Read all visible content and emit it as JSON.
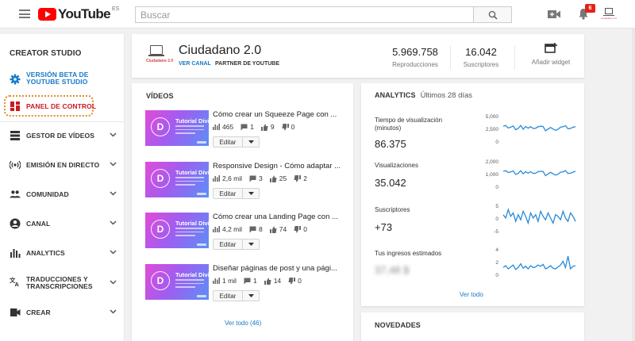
{
  "topbar": {
    "logo_text": "YouTube",
    "logo_region": "ES",
    "search_placeholder": "Buscar",
    "notification_count": "6",
    "avatar_text": "Ciudadano 2.0"
  },
  "sidebar": {
    "heading": "CREATOR STUDIO",
    "items": [
      {
        "label": "VERSIÓN BETA DE\nYOUTUBE STUDIO",
        "icon": "gear-icon"
      },
      {
        "label": "PANEL DE CONTROL",
        "icon": "dashboard-icon"
      },
      {
        "label": "GESTOR DE VÍDEOS",
        "icon": "video-manager-icon"
      },
      {
        "label": "EMISIÓN EN DIRECTO",
        "icon": "live-icon"
      },
      {
        "label": "COMUNIDAD",
        "icon": "community-icon"
      },
      {
        "label": "CANAL",
        "icon": "channel-icon"
      },
      {
        "label": "ANALYTICS",
        "icon": "analytics-icon"
      },
      {
        "label": "TRADUCCIONES Y\nTRANSCRIPCIONES",
        "icon": "translate-icon"
      },
      {
        "label": "CREAR",
        "icon": "create-icon"
      }
    ]
  },
  "channel": {
    "name": "Ciudadano 2.0",
    "avatar_text": "Ciudadano 2.0",
    "view_channel": "VER CANAL",
    "partner": "PARTNER DE YOUTUBE",
    "stats": [
      {
        "value": "5.969.758",
        "label": "Reproducciones"
      },
      {
        "value": "16.042",
        "label": "Suscriptores"
      }
    ],
    "add_widget": "Añadir widget"
  },
  "videos": {
    "title": "VÍDEOS",
    "edit_label": "Editar",
    "see_all": "Ver todo (46)",
    "items": [
      {
        "title": "Cómo crear un Squeeze Page con ...",
        "thumb_title": "Tutorial Divi",
        "views": "465",
        "comments": "1",
        "likes": "9",
        "dislikes": "0"
      },
      {
        "title": "Responsive Design - Cómo adaptar ...",
        "thumb_title": "Tutorial Divi",
        "views": "2,6 mil",
        "comments": "3",
        "likes": "25",
        "dislikes": "2"
      },
      {
        "title": "Cómo crear una Landing Page con ...",
        "thumb_title": "Tutorial Divi",
        "views": "4,2 mil",
        "comments": "8",
        "likes": "74",
        "dislikes": "0"
      },
      {
        "title": "Diseñar páginas de post y una pági...",
        "thumb_title": "Tutorial Divi",
        "views": "1 mil",
        "comments": "1",
        "likes": "14",
        "dislikes": "0"
      }
    ]
  },
  "analytics": {
    "title": "ANALYTICS",
    "period": "Últimos 28 días",
    "see_all": "Ver todo",
    "metrics": [
      {
        "label": "Tiempo de visualización (minutos)",
        "value": "86.375",
        "ticks": [
          "5,000",
          "2,500",
          "0"
        ],
        "points": [
          3100,
          3250,
          2750,
          2900,
          3150,
          2400,
          2650,
          3250,
          2500,
          3050,
          2700,
          3000,
          2650,
          2700,
          3000,
          3100,
          3050,
          2200,
          2550,
          2850,
          2550,
          2300,
          2500,
          2900,
          3000,
          3200,
          2600,
          2650,
          2900,
          3000
        ],
        "ymax": 5000,
        "ymin": 0
      },
      {
        "label": "Visualizaciones",
        "value": "35.042",
        "ticks": [
          "2,000",
          "1,000",
          "0"
        ],
        "points": [
          1250,
          1300,
          1150,
          1200,
          1280,
          1000,
          1080,
          1300,
          1050,
          1230,
          1100,
          1220,
          1080,
          1100,
          1220,
          1250,
          1230,
          900,
          1050,
          1170,
          1050,
          950,
          1020,
          1180,
          1210,
          1300,
          1080,
          1100,
          1180,
          1250
        ],
        "ymax": 2000,
        "ymin": 0
      },
      {
        "label": "Suscriptores",
        "value": "+73",
        "ticks": [
          "5",
          "0",
          "-5"
        ],
        "points": [
          3,
          1,
          6,
          2,
          4,
          -1,
          3,
          0,
          5,
          2,
          -2,
          4,
          1,
          3,
          -1,
          5,
          2,
          0,
          4,
          1,
          -2,
          3,
          2,
          0,
          5,
          1,
          -1,
          4,
          2,
          -1
        ],
        "ymax": 8,
        "ymin": -7
      },
      {
        "label": "Tus ingresos estimados",
        "value": "37,48 $",
        "ticks": [
          "4",
          "2",
          "0"
        ],
        "points": [
          1.2,
          1.5,
          1.0,
          1.3,
          1.6,
          0.9,
          1.2,
          1.8,
          1.1,
          1.4,
          1.0,
          1.5,
          1.2,
          1.3,
          1.6,
          1.4,
          1.7,
          1.0,
          1.2,
          1.5,
          1.1,
          1.0,
          1.3,
          1.6,
          2.2,
          1.2,
          3.0,
          1.0,
          1.4,
          1.5
        ],
        "ymax": 4,
        "ymin": 0
      }
    ]
  },
  "news": {
    "title": "NOVEDADES"
  },
  "colors": {
    "accent_blue": "#167ac6",
    "youtube_red": "#ff0000",
    "active_red": "#cc181e",
    "highlight_orange": "#e38e29",
    "chart_line": "#2a8ad6"
  }
}
